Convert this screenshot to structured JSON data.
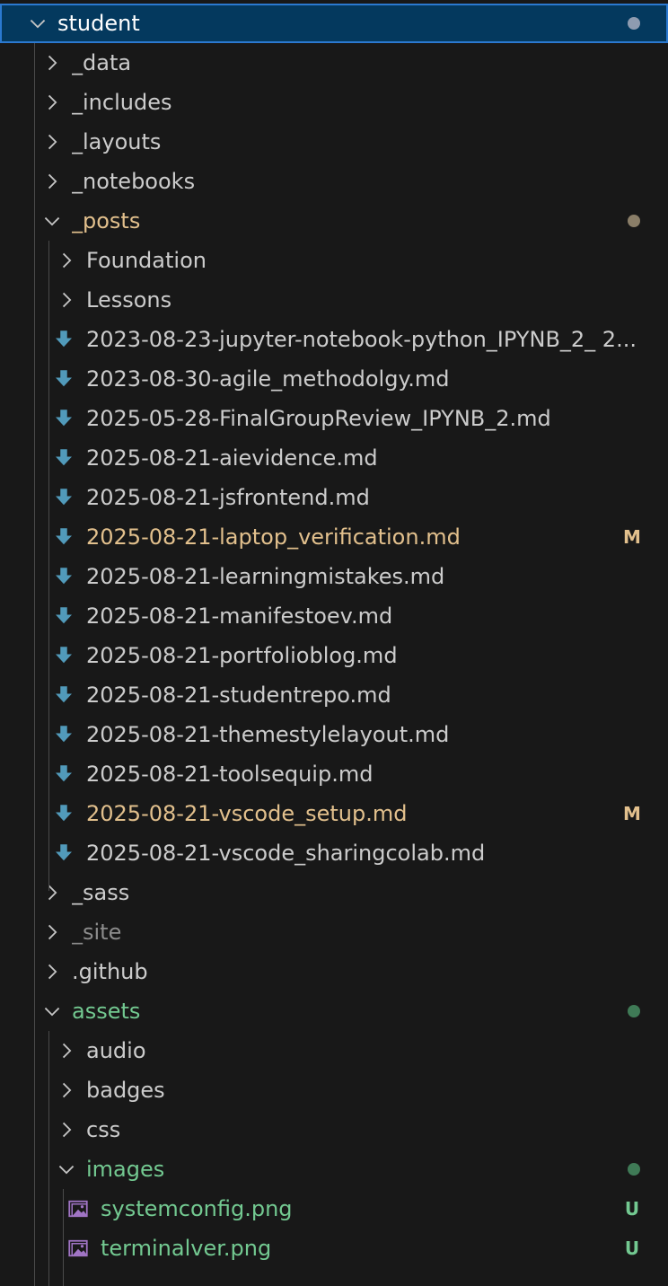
{
  "colors": {
    "default_text": "#cccccc",
    "modified": "#e2c08d",
    "untracked": "#73c991",
    "ignored": "#8c8c8c",
    "selected_bg": "#04395e",
    "selected_border": "#2b79d0",
    "markdown_icon": "#519aba",
    "image_icon": "#a074c4"
  },
  "root": {
    "label": "student",
    "expanded": true,
    "status_dot": "#8e9bb0"
  },
  "folders_top": [
    {
      "label": "_data",
      "expanded": false
    },
    {
      "label": "_includes",
      "expanded": false
    },
    {
      "label": "_layouts",
      "expanded": false
    },
    {
      "label": "_notebooks",
      "expanded": false
    }
  ],
  "posts": {
    "label": "_posts",
    "expanded": true,
    "status": "modified",
    "status_dot": "#8a7e68",
    "subfolders": [
      {
        "label": "Foundation",
        "expanded": false
      },
      {
        "label": "Lessons",
        "expanded": false
      }
    ],
    "files": [
      {
        "label": "2023-08-23-jupyter-notebook-python_IPYNB_2_ 2...",
        "icon": "markdown-icon",
        "status": "",
        "badge": ""
      },
      {
        "label": "2023-08-30-agile_methodolgy.md",
        "icon": "markdown-icon",
        "status": "",
        "badge": ""
      },
      {
        "label": "2025-05-28-FinalGroupReview_IPYNB_2.md",
        "icon": "markdown-icon",
        "status": "",
        "badge": ""
      },
      {
        "label": "2025-08-21-aievidence.md",
        "icon": "markdown-icon",
        "status": "",
        "badge": ""
      },
      {
        "label": "2025-08-21-jsfrontend.md",
        "icon": "markdown-icon",
        "status": "",
        "badge": ""
      },
      {
        "label": "2025-08-21-laptop_verification.md",
        "icon": "markdown-icon",
        "status": "modified",
        "badge": "M"
      },
      {
        "label": "2025-08-21-learningmistakes.md",
        "icon": "markdown-icon",
        "status": "",
        "badge": ""
      },
      {
        "label": "2025-08-21-manifestoev.md",
        "icon": "markdown-icon",
        "status": "",
        "badge": ""
      },
      {
        "label": "2025-08-21-portfolioblog.md",
        "icon": "markdown-icon",
        "status": "",
        "badge": ""
      },
      {
        "label": "2025-08-21-studentrepo.md",
        "icon": "markdown-icon",
        "status": "",
        "badge": ""
      },
      {
        "label": "2025-08-21-themestylelayout.md",
        "icon": "markdown-icon",
        "status": "",
        "badge": ""
      },
      {
        "label": "2025-08-21-toolsequip.md",
        "icon": "markdown-icon",
        "status": "",
        "badge": ""
      },
      {
        "label": "2025-08-21-vscode_setup.md",
        "icon": "markdown-icon",
        "status": "modified",
        "badge": "M"
      },
      {
        "label": "2025-08-21-vscode_sharingcolab.md",
        "icon": "markdown-icon",
        "status": "",
        "badge": ""
      }
    ]
  },
  "folders_mid": [
    {
      "label": "_sass",
      "expanded": false,
      "status": ""
    },
    {
      "label": "_site",
      "expanded": false,
      "status": "ignored"
    },
    {
      "label": ".github",
      "expanded": false,
      "status": ""
    }
  ],
  "assets": {
    "label": "assets",
    "expanded": true,
    "status": "untracked",
    "status_dot": "#3f7a56",
    "subfolders": [
      {
        "label": "audio",
        "expanded": false
      },
      {
        "label": "badges",
        "expanded": false
      },
      {
        "label": "css",
        "expanded": false
      }
    ],
    "images": {
      "label": "images",
      "expanded": true,
      "status": "untracked",
      "status_dot": "#3f7a56",
      "files": [
        {
          "label": "systemconfig.png",
          "icon": "image-file-icon",
          "status": "untracked",
          "badge": "U"
        },
        {
          "label": "terminalver.png",
          "icon": "image-file-icon",
          "status": "untracked",
          "badge": "U"
        }
      ]
    }
  }
}
